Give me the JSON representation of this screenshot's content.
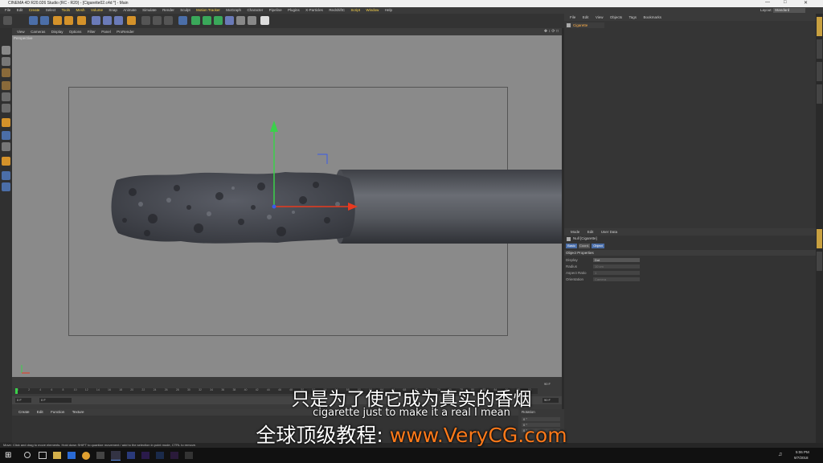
{
  "window": {
    "title": "CINEMA 4D R20.026 Studio (RC - R20) - [Cigarette02.c4d *] - Main",
    "layout_label": "Layout:",
    "layout_value": "Standard"
  },
  "menubar": {
    "items": [
      "File",
      "Edit",
      "Create",
      "Select",
      "Tools",
      "Mesh",
      "Volume",
      "Snap",
      "Animate",
      "Simulate",
      "Render",
      "Sculpt",
      "Motion Tracker",
      "MoGraph",
      "Character",
      "Pipeline",
      "Plugins",
      "X-Particles",
      "RedshiftC",
      "Script",
      "Window",
      "Help"
    ]
  },
  "viewport": {
    "menu": [
      "View",
      "Cameras",
      "Display",
      "Options",
      "Filter",
      "Panel",
      "ProRender"
    ],
    "label": "Perspective"
  },
  "timeline": {
    "ticks": [
      "0",
      "2",
      "4",
      "6",
      "8",
      "10",
      "12",
      "14",
      "16",
      "18",
      "20",
      "22",
      "24",
      "26",
      "28",
      "30",
      "32",
      "34",
      "36",
      "38",
      "40",
      "42",
      "44",
      "46",
      "48",
      "50",
      "52",
      "54",
      "56",
      "58",
      "60",
      "62",
      "64",
      "66",
      "68",
      "70",
      "72",
      "74",
      "76",
      "78",
      "80",
      "82",
      "84",
      "86",
      "88",
      "90"
    ],
    "end_frame": "90 F",
    "current_frame": "0 F",
    "start_field": "0 F"
  },
  "material_manager": {
    "menu": [
      "Create",
      "Edit",
      "Function",
      "Texture"
    ]
  },
  "coords": {
    "header": "Rotation",
    "values": [
      "0 °",
      "0 °",
      "0 °"
    ]
  },
  "objects_panel": {
    "menu": [
      "File",
      "Edit",
      "View",
      "Objects",
      "Tags",
      "Bookmarks"
    ],
    "object_name": "Cigarette"
  },
  "attributes_panel": {
    "menu": [
      "Mode",
      "Edit",
      "User Data"
    ],
    "title": "Null [Cigarette]",
    "tabs": [
      "Basic",
      "Coord.",
      "Object"
    ],
    "section": "Object Properties",
    "props": [
      {
        "label": "Display",
        "value": "Dot"
      },
      {
        "label": "Radius",
        "value": "10 cm"
      },
      {
        "label": "Aspect Ratio",
        "value": "1"
      },
      {
        "label": "Orientation",
        "value": "Camera"
      }
    ]
  },
  "statusbar": {
    "text": "Move: Click and drag to move elements. Hold down SHIFT to quantize movement / add to the selection in point mode, CTRL to remove."
  },
  "taskbar": {
    "time": "5:06 PM",
    "date": "9/7/2018"
  },
  "subtitles": {
    "chinese": "只是为了使它成为真实的香烟",
    "english": "cigarette just to make it a real I mean",
    "brand_prefix": "全球顶级教程:",
    "brand_url": "www.VeryCG.com"
  },
  "colors": {
    "accent_yellow": "#ffd84a",
    "watermark_orange": "#ff7a1a",
    "selected_tab_blue": "#4b6ea8",
    "axis_x": "#e83a1f",
    "axis_y": "#3ad14a",
    "axis_z": "#3a5ce8"
  }
}
